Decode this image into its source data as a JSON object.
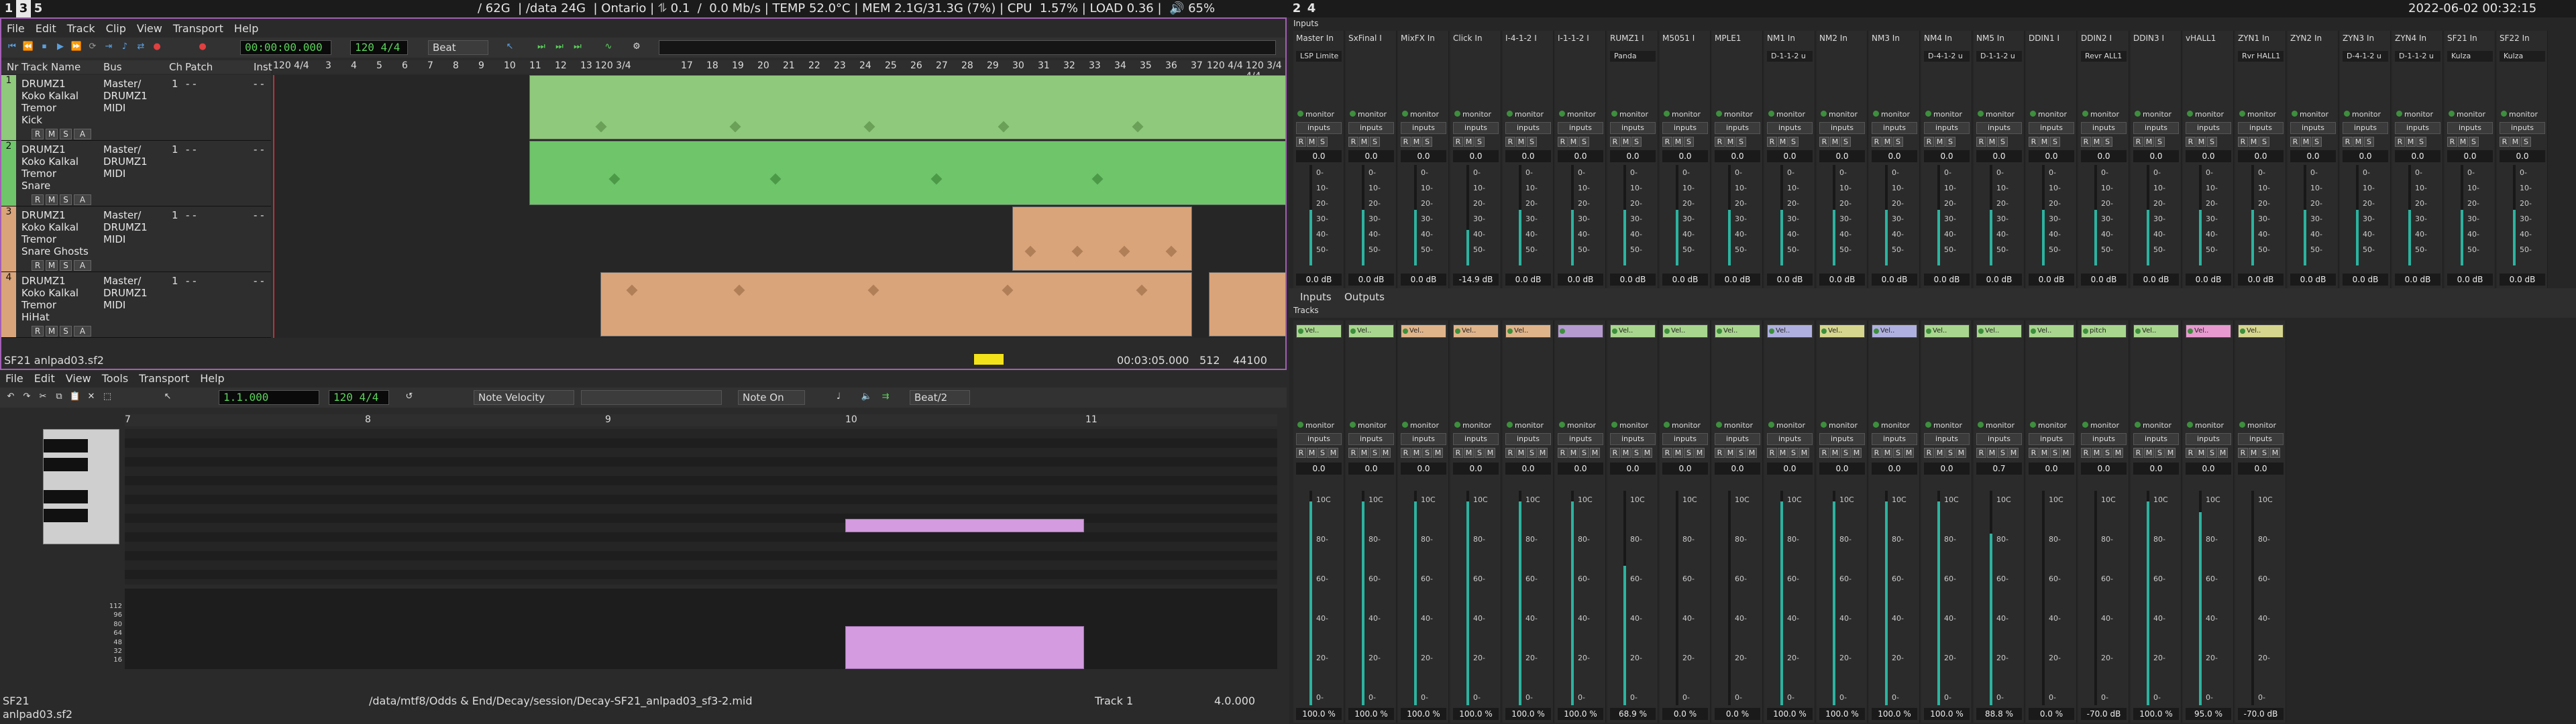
{
  "topbar": {
    "workspaces": [
      "1",
      "3",
      "5"
    ],
    "active_ws": "3",
    "status": "/ 62G  | /data 24G  | Ontario | ⥮ 0.1  /  0.0 Mb/s | TEMP 52.0°C | MEM 2.1G/31.3G (7%) | CPU  1.57% | LOAD 0.36 |  🔊 65%",
    "ws2": [
      "2",
      "4"
    ],
    "datetime": "2022-06-02 00:32:15"
  },
  "daw": {
    "menu": [
      "File",
      "Edit",
      "Track",
      "Clip",
      "View",
      "Transport",
      "Help"
    ],
    "time": "00:00:00.000",
    "tempo": "120 4/4",
    "snap": "Beat",
    "cols": [
      "Nr",
      "Track Name",
      "Bus",
      "Ch",
      "Patch",
      "Inst"
    ],
    "ruler": [
      "3",
      "4",
      "5",
      "6",
      "7",
      "8",
      "9",
      "10",
      "11",
      "12",
      "13",
      "17",
      "18",
      "19",
      "20",
      "21",
      "22",
      "23",
      "24",
      "25",
      "26",
      "27",
      "28",
      "29",
      "30",
      "31",
      "32",
      "33",
      "34",
      "35",
      "36",
      "37"
    ],
    "ruler_tempo": [
      "120 4/4",
      "120 3/4",
      "120 4/4",
      "120 3/4 4/4"
    ],
    "tracks": [
      {
        "nr": "1",
        "name": "DRUMZ1\nKoko Kalkal\nTremor\nKick",
        "bus": "Master/\nDRUMZ1\nMIDI",
        "ch": "1",
        "patch": "- -",
        "inst": "- -"
      },
      {
        "nr": "2",
        "name": "DRUMZ1\nKoko Kalkal\nTremor\nSnare",
        "bus": "Master/\nDRUMZ1\nMIDI",
        "ch": "1",
        "patch": "- -",
        "inst": "- -"
      },
      {
        "nr": "3",
        "name": "DRUMZ1\nKoko Kalkal\nTremor\nSnare Ghosts",
        "bus": "Master/\nDRUMZ1\nMIDI",
        "ch": "1",
        "patch": "- -",
        "inst": "- -"
      },
      {
        "nr": "4",
        "name": "DRUMZ1\nKoko Kalkal\nTremor\nHiHat",
        "bus": "Master/\nDRUMZ1\nMIDI",
        "ch": "1",
        "patch": "- -",
        "inst": "- -"
      }
    ],
    "buttons": [
      "R",
      "M",
      "S",
      "A"
    ],
    "status_left": "SF21 anlpad03.sf2",
    "status_time": "00:03:05.000",
    "status_n1": "512",
    "status_n2": "44100",
    "colors": {
      "green": "#8fc97b",
      "green2": "#6ec56a",
      "tan": "#d9a47a",
      "border": "#a35fb5",
      "yellow": "#f3e21a"
    }
  },
  "piano": {
    "menu": [
      "File",
      "Edit",
      "View",
      "Tools",
      "Transport",
      "Help"
    ],
    "pos": "1.1.000",
    "tempo": "120 4/4",
    "ctrl": "Note Velocity",
    "event": "Note On",
    "snap": "Beat/2",
    "ruler": [
      "7",
      "8",
      "9",
      "10",
      "11"
    ],
    "velocity_labels": [
      "112",
      "96",
      "80",
      "64",
      "48",
      "32",
      "16"
    ],
    "status_name": "SF21",
    "status_file": "anlpad03.sf2",
    "status_path": "/data/mtf8/Odds & End/Decay/session/Decay-SF21_anlpad03_sf3-2.mid",
    "status_track": "Track 1",
    "status_pos": "4.0.000"
  },
  "mixer": {
    "inputs_label": "Inputs",
    "inputs": [
      {
        "name": "Master In",
        "tag": "LSP Limite",
        "gain": "0.0",
        "db": "0.0 dB",
        "fill": 0.55
      },
      {
        "name": "SxFinal I",
        "tag": "",
        "gain": "0.0",
        "db": "0.0 dB",
        "fill": 0.55
      },
      {
        "name": "MixFX In",
        "tag": "",
        "gain": "0.0",
        "db": "0.0 dB",
        "fill": 0.55
      },
      {
        "name": "Click In",
        "tag": "",
        "gain": "0.0",
        "db": "-14.9 dB",
        "fill": 0.35
      },
      {
        "name": "I-4-1-2 I",
        "tag": "",
        "gain": "0.0",
        "db": "0.0 dB",
        "fill": 0.55
      },
      {
        "name": "I-1-1-2 I",
        "tag": "",
        "gain": "0.0",
        "db": "0.0 dB",
        "fill": 0.55
      },
      {
        "name": "RUMZ1 I",
        "tag": "Panda",
        "gain": "0.0",
        "db": "0.0 dB",
        "fill": 0.55
      },
      {
        "name": "M5051 I",
        "tag": "",
        "gain": "0.0",
        "db": "0.0 dB",
        "fill": 0.55
      },
      {
        "name": "MPLE1",
        "tag": "",
        "gain": "0.0",
        "db": "0.0 dB",
        "fill": 0.55
      },
      {
        "name": "NM1 In",
        "tag": "D-1-1-2 u",
        "gain": "0.0",
        "db": "0.0 dB",
        "fill": 0.55
      },
      {
        "name": "NM2 In",
        "tag": "",
        "gain": "0.0",
        "db": "0.0 dB",
        "fill": 0.55
      },
      {
        "name": "NM3 In",
        "tag": "",
        "gain": "0.0",
        "db": "0.0 dB",
        "fill": 0.55
      },
      {
        "name": "NM4 In",
        "tag": "D-4-1-2 u",
        "gain": "0.0",
        "db": "0.0 dB",
        "fill": 0.55
      },
      {
        "name": "NM5 In",
        "tag": "D-1-1-2 u",
        "gain": "0.0",
        "db": "0.0 dB",
        "fill": 0.55
      },
      {
        "name": "DDIN1 I",
        "tag": "",
        "gain": "0.0",
        "db": "0.0 dB",
        "fill": 0.55
      },
      {
        "name": "DDIN2 I",
        "tag": "Revr ALL1",
        "gain": "0.0",
        "db": "0.0 dB",
        "fill": 0.55
      },
      {
        "name": "DDIN3 I",
        "tag": "",
        "gain": "0.0",
        "db": "0.0 dB",
        "fill": 0.55
      },
      {
        "name": "vHALL1",
        "tag": "",
        "gain": "0.0",
        "db": "0.0 dB",
        "fill": 0.55
      },
      {
        "name": "ZYN1 In",
        "tag": "Rvr HALL1",
        "gain": "0.0",
        "db": "0.0 dB",
        "fill": 0.55
      },
      {
        "name": "ZYN2 In",
        "tag": "",
        "gain": "0.0",
        "db": "0.0 dB",
        "fill": 0.55
      },
      {
        "name": "ZYN3 In",
        "tag": "D-4-1-2 u",
        "gain": "0.0",
        "db": "0.0 dB",
        "fill": 0.55
      },
      {
        "name": "ZYN4 In",
        "tag": "D-1-1-2 u",
        "gain": "0.0",
        "db": "0.0 dB",
        "fill": 0.55
      },
      {
        "name": "SF21 In",
        "tag": "Kulza",
        "gain": "0.0",
        "db": "0.0 dB",
        "fill": 0.55
      },
      {
        "name": "SF22 In",
        "tag": "Kulza",
        "gain": "0.0",
        "db": "0.0 dB",
        "fill": 0.55
      }
    ],
    "tabs": [
      "Inputs",
      "Outputs"
    ],
    "tracks_label": "Tracks",
    "tracks": [
      {
        "plug": "Vel..",
        "color": "#a8d68e",
        "gain": "0.0",
        "db": "100.0 %",
        "fill": 0.95
      },
      {
        "plug": "Vel..",
        "color": "#a8d68e",
        "gain": "0.0",
        "db": "100.0 %",
        "fill": 0.95
      },
      {
        "plug": "Vel..",
        "color": "#e0b48a",
        "gain": "0.0",
        "db": "100.0 %",
        "fill": 0.95
      },
      {
        "plug": "Vel..",
        "color": "#e0b48a",
        "gain": "0.0",
        "db": "100.0 %",
        "fill": 0.95
      },
      {
        "plug": "Vel..",
        "color": "#e0b48a",
        "gain": "0.0",
        "db": "100.0 %",
        "fill": 0.95
      },
      {
        "plug": "",
        "color": "#b59ad0",
        "gain": "0.0",
        "db": "100.0 %",
        "fill": 0.95
      },
      {
        "plug": "Vel..",
        "color": "#a8d68e",
        "gain": "0.0",
        "db": "68.9 %",
        "fill": 0.65
      },
      {
        "plug": "Vel..",
        "color": "#a8d68e",
        "gain": "0.0",
        "db": "0.0 %",
        "fill": 0.0
      },
      {
        "plug": "Vel..",
        "color": "#a8d68e",
        "gain": "0.0",
        "db": "0.0 %",
        "fill": 0.0
      },
      {
        "plug": "Vel..",
        "color": "#b0b0e0",
        "gain": "0.0",
        "db": "100.0 %",
        "fill": 0.95
      },
      {
        "plug": "Vel..",
        "color": "#d6d68e",
        "gain": "0.0",
        "db": "100.0 %",
        "fill": 0.95
      },
      {
        "plug": "Vel..",
        "color": "#b0b0e0",
        "gain": "0.0",
        "db": "100.0 %",
        "fill": 0.95
      },
      {
        "plug": "Vel..",
        "color": "#a8d68e",
        "gain": "0.0",
        "db": "100.0 %",
        "fill": 0.95
      },
      {
        "plug": "Vel..",
        "color": "#a8d68e",
        "gain": "0.7",
        "db": "88.8 %",
        "fill": 0.8
      },
      {
        "plug": "Vel..",
        "color": "#a8d68e",
        "gain": "0.0",
        "db": "0.0 %",
        "fill": 0.0
      },
      {
        "plug": "pitch",
        "color": "#a8d68e",
        "gain": "0.0",
        "db": "-70.0 dB",
        "fill": 0.0
      },
      {
        "plug": "Vel..",
        "color": "#a8d68e",
        "gain": "0.0",
        "db": "100.0 %",
        "fill": 0.95
      },
      {
        "plug": "Vel..",
        "color": "#e89ad0",
        "gain": "0.0",
        "db": "95.0 %",
        "fill": 0.9
      },
      {
        "plug": "Vel..",
        "color": "#d6d68e",
        "gain": "0.0",
        "db": "-70.0 dB",
        "fill": 0.0
      }
    ],
    "scale": [
      "10C",
      "80-",
      "60-",
      "40-",
      "20-",
      "0-"
    ],
    "in_scale": [
      "0-",
      "10-",
      "20-",
      "30-",
      "40-",
      "50-"
    ]
  }
}
